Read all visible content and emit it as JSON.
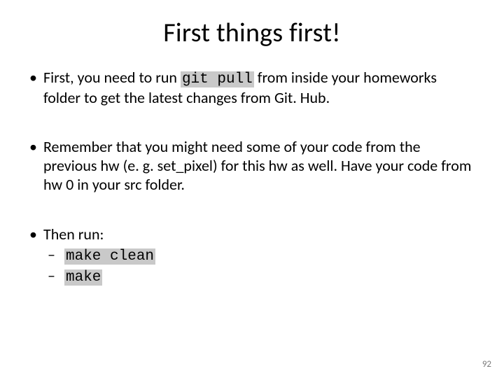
{
  "title": "First things first!",
  "bullets": {
    "b1": {
      "pre": "First, you need to run ",
      "code": "git pull",
      "post": " from inside your homeworks folder to get the latest changes from Git. Hub."
    },
    "b2": "Remember that you might need some of your code from the previous hw (e. g. set_pixel) for this hw as well. Have your code from hw 0 in your src folder.",
    "b3": {
      "label": "Then run:",
      "sub1": "make clean",
      "sub2": "make"
    }
  },
  "page_number": "92"
}
